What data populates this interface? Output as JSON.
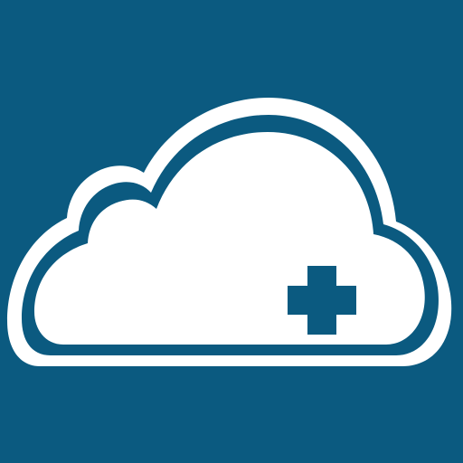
{
  "app_icon": {
    "background_color": "#0B5A80",
    "cloud_color": "#FFFFFF",
    "plus_color": "#0B5A80",
    "icon_names": [
      "cloud-icon",
      "plus-icon"
    ]
  }
}
